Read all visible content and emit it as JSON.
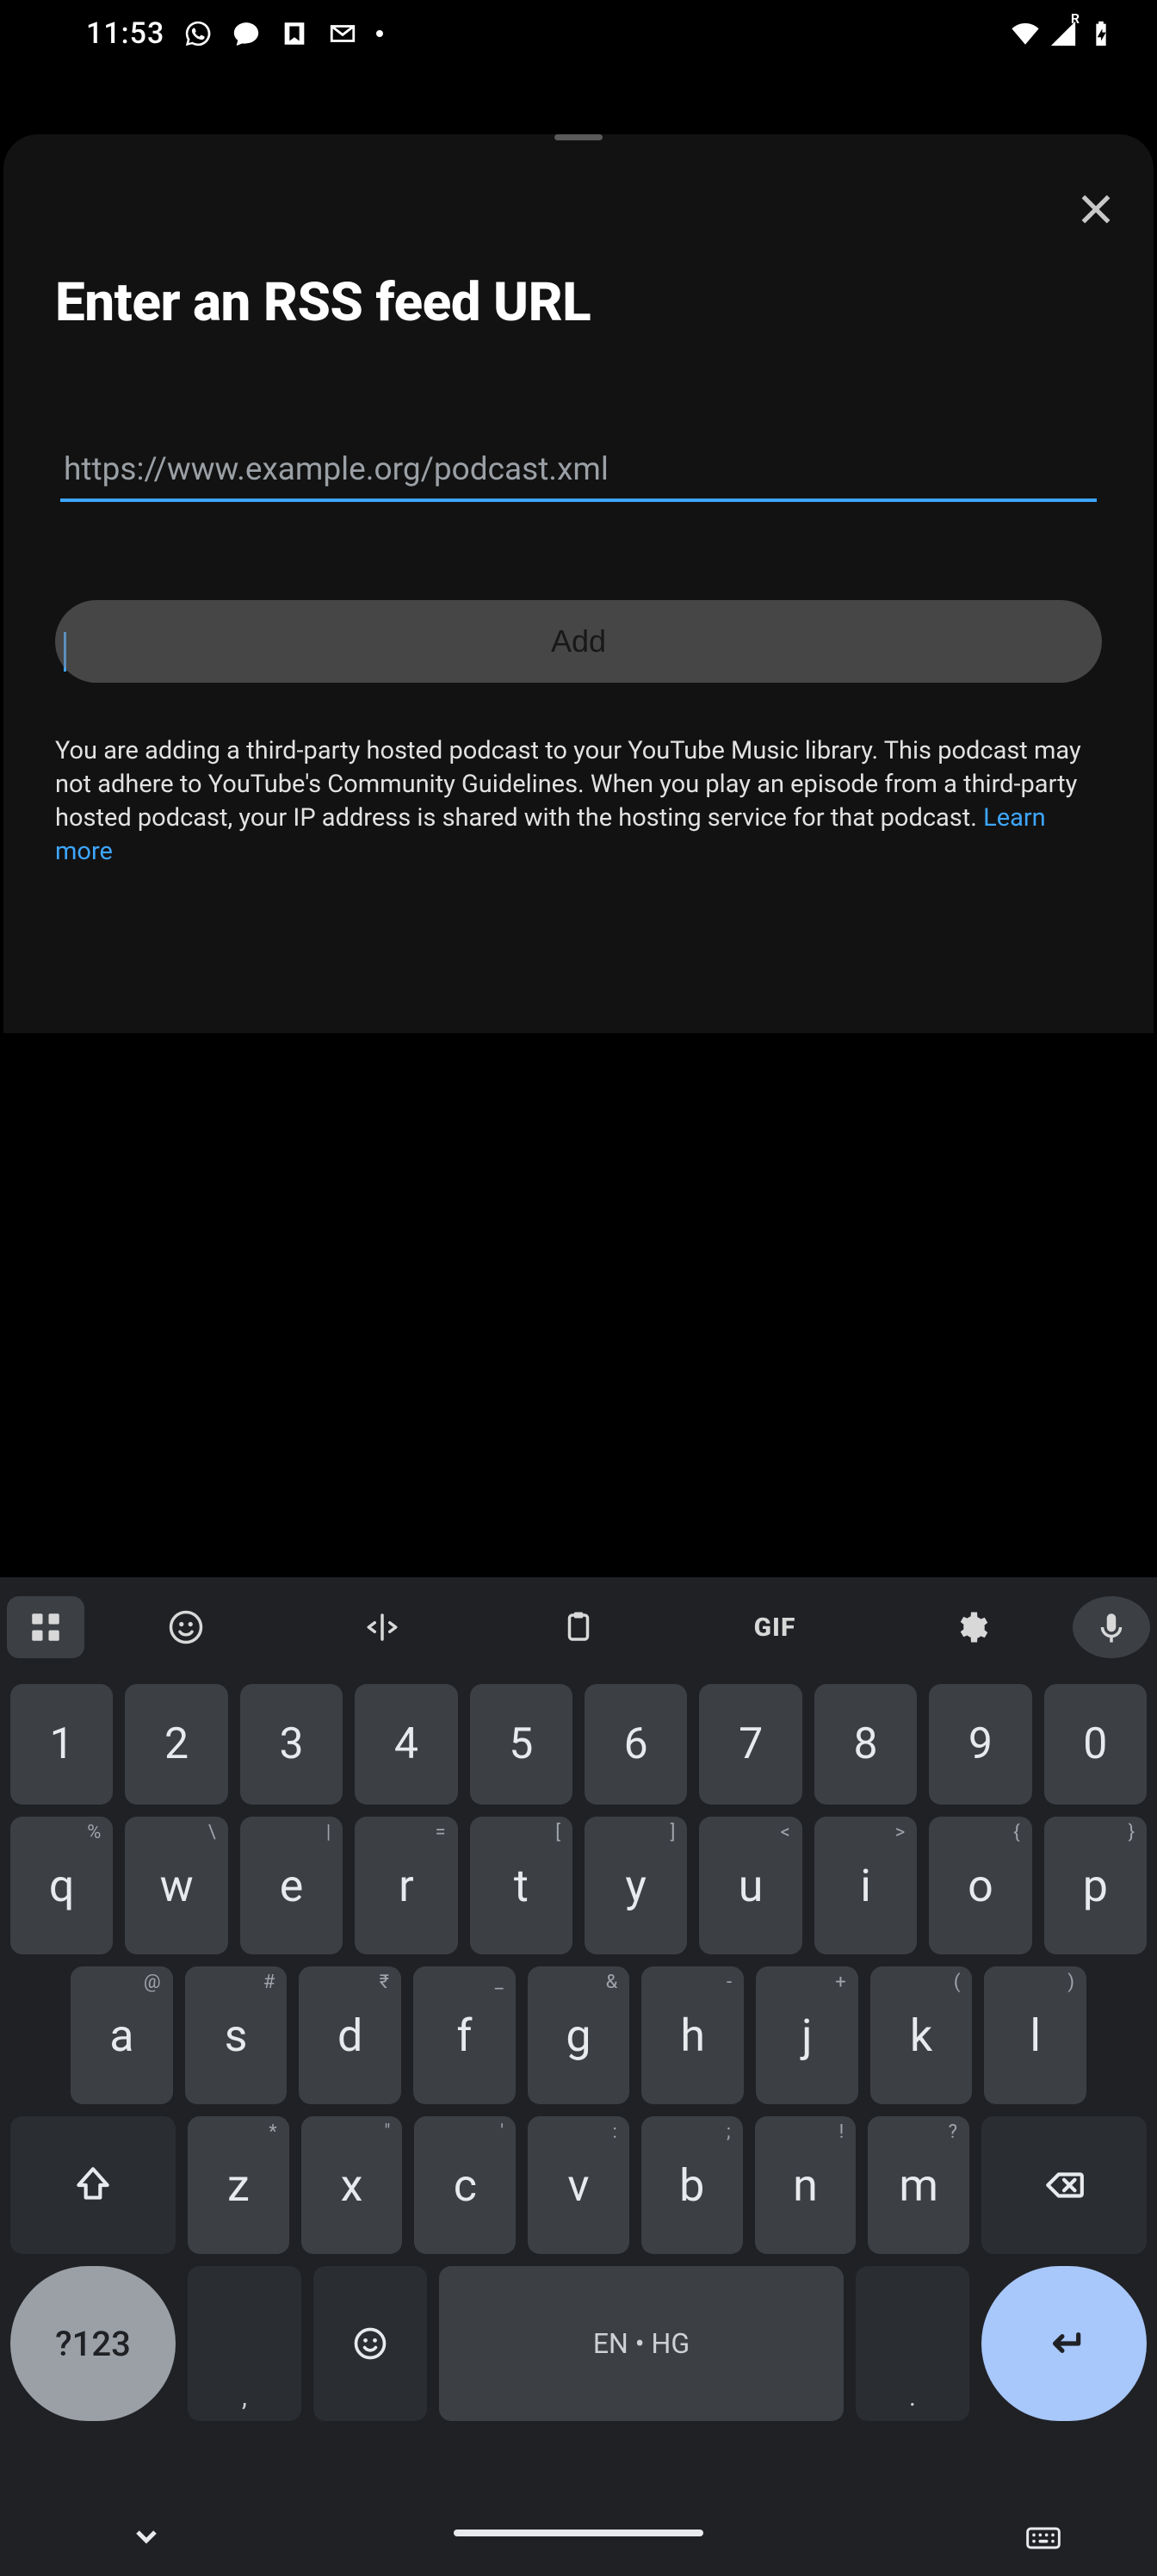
{
  "status": {
    "time": "11:53",
    "roaming": "R"
  },
  "sheet": {
    "title": "Enter an RSS feed URL",
    "url_placeholder": "https://www.example.org/podcast.xml",
    "add_label": "Add",
    "disclaimer": "You are adding a third-party hosted podcast to your YouTube Music library. This podcast may not adhere to YouTube's Community Guidelines. When you play an episode from a third-party hosted podcast, your IP address is shared with the hosting service for that podcast. ",
    "learn_more": "Learn more"
  },
  "keyboard": {
    "toolbar": {
      "gif": "GIF"
    },
    "row_num": [
      "1",
      "2",
      "3",
      "4",
      "5",
      "6",
      "7",
      "8",
      "9",
      "0"
    ],
    "row_q": {
      "keys": [
        "q",
        "w",
        "e",
        "r",
        "t",
        "y",
        "u",
        "i",
        "o",
        "p"
      ],
      "hints": [
        "%",
        "\\",
        "|",
        "=",
        "[",
        "]",
        "<",
        ">",
        "{",
        "}"
      ]
    },
    "row_a": {
      "keys": [
        "a",
        "s",
        "d",
        "f",
        "g",
        "h",
        "j",
        "k",
        "l"
      ],
      "hints": [
        "@",
        "#",
        "₹",
        "_",
        "&",
        "-",
        "+",
        "(",
        ")"
      ]
    },
    "row_z": {
      "keys": [
        "z",
        "x",
        "c",
        "v",
        "b",
        "n",
        "m"
      ],
      "hints": [
        "*",
        "\"",
        "'",
        ":",
        ";",
        "!",
        "?"
      ]
    },
    "sym": "?123",
    "comma_hint": ",",
    "period_hint": ".",
    "space_label": "EN • HG"
  }
}
